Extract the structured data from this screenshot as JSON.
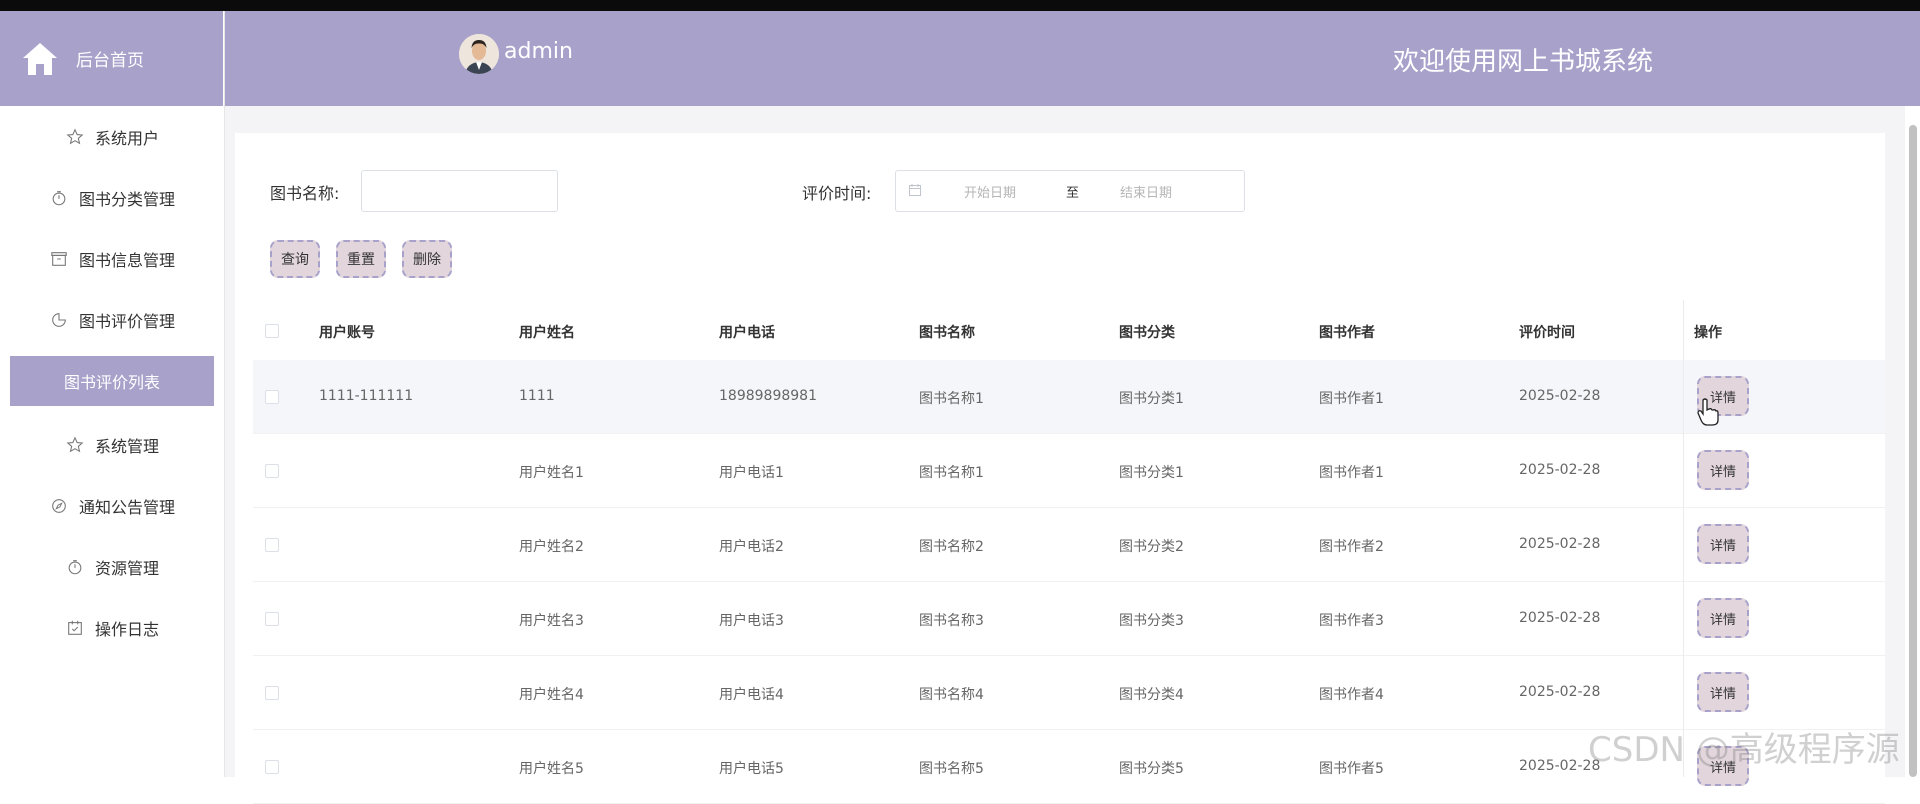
{
  "sidebar": {
    "home_label": "后台首页",
    "items": [
      {
        "label": "系统用户",
        "icon": "star-icon"
      },
      {
        "label": "图书分类管理",
        "icon": "timer-icon"
      },
      {
        "label": "图书信息管理",
        "icon": "box-icon"
      },
      {
        "label": "图书评价管理",
        "icon": "pie-icon"
      },
      {
        "label": "图书评价列表",
        "icon": "",
        "active": true
      },
      {
        "label": "系统管理",
        "icon": "star-icon"
      },
      {
        "label": "通知公告管理",
        "icon": "compass-icon"
      },
      {
        "label": "资源管理",
        "icon": "timer-icon"
      },
      {
        "label": "操作日志",
        "icon": "calendar-check-icon"
      }
    ]
  },
  "header": {
    "username": "admin",
    "welcome": "欢迎使用网上书城系统"
  },
  "search": {
    "book_name_label": "图书名称:",
    "book_name_value": "",
    "eval_time_label": "评价时间:",
    "start_placeholder": "开始日期",
    "range_separator": "至",
    "end_placeholder": "结束日期",
    "query_label": "查询",
    "reset_label": "重置",
    "delete_label": "删除"
  },
  "table": {
    "headers": [
      "用户账号",
      "用户姓名",
      "用户电话",
      "图书名称",
      "图书分类",
      "图书作者",
      "评价时间",
      "操作"
    ],
    "detail_label": "详情",
    "rows": [
      [
        "1111-111111",
        "1111",
        "18989898981",
        "图书名称1",
        "图书分类1",
        "图书作者1",
        "2025-02-28"
      ],
      [
        "",
        "用户姓名1",
        "用户电话1",
        "图书名称1",
        "图书分类1",
        "图书作者1",
        "2025-02-28"
      ],
      [
        "",
        "用户姓名2",
        "用户电话2",
        "图书名称2",
        "图书分类2",
        "图书作者2",
        "2025-02-28"
      ],
      [
        "",
        "用户姓名3",
        "用户电话3",
        "图书名称3",
        "图书分类3",
        "图书作者3",
        "2025-02-28"
      ],
      [
        "",
        "用户姓名4",
        "用户电话4",
        "图书名称4",
        "图书分类4",
        "图书作者4",
        "2025-02-28"
      ],
      [
        "",
        "用户姓名5",
        "用户电话5",
        "图书名称5",
        "图书分类5",
        "图书作者5",
        "2025-02-28"
      ]
    ]
  },
  "watermark": "CSDN @高级程序源",
  "colors": {
    "accent": "#a8a2cb",
    "button_bg": "#e2d6dc",
    "topbar": "#0b0b0b"
  }
}
